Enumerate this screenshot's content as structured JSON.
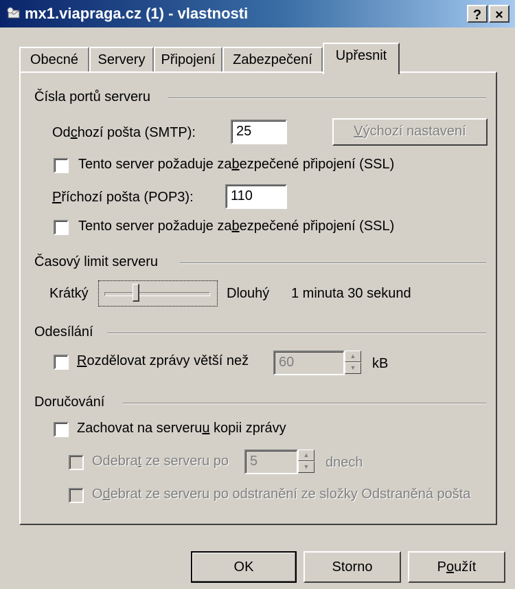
{
  "window": {
    "title": "mx1.viapraga.cz (1) - vlastnosti",
    "help_button": "?",
    "close_button": "×"
  },
  "tabs": [
    {
      "label": "Obecné",
      "active": false
    },
    {
      "label": "Servery",
      "active": false
    },
    {
      "label": "Připojení",
      "active": false
    },
    {
      "label": "Zabezpečení",
      "active": false
    },
    {
      "label": "Upřesnit",
      "active": true
    }
  ],
  "ports": {
    "group_label": "Čísla portů serveru",
    "smtp": {
      "label_pre": "Od",
      "label_ul": "c",
      "label_post": "hozí pošta (SMTP):",
      "value": "25"
    },
    "smtp_ssl": {
      "label_pre": "Tento server požaduje za",
      "label_ul": "b",
      "label_post": "ezpečené připojení (SSL)",
      "checked": false
    },
    "pop3": {
      "label_pre": "",
      "label_ul": "P",
      "label_post": "říchozí pošta (POP3):",
      "value": "110"
    },
    "pop3_ssl": {
      "label_pre": "Tento server požaduje za",
      "label_ul": "b",
      "label_post": "ezpečené připojení (SSL)",
      "checked": false
    },
    "default_button": {
      "label_pre": "",
      "label_ul": "V",
      "label_post": "ýchozí nastavení",
      "disabled": true
    }
  },
  "timeout": {
    "group_label": "Časový limit serveru",
    "short_label": "Krátký",
    "long_label": "Dlouhý",
    "value_text": "1 minuta 30 sekund",
    "level": 0.3
  },
  "sending": {
    "group_label": "Odesílání",
    "split": {
      "label_pre": "",
      "label_ul": "R",
      "label_post": "ozdělovat zprávy větší než",
      "checked": false
    },
    "split_value": "60",
    "unit": "kB"
  },
  "delivery": {
    "group_label": "Doručování",
    "keep_copy": {
      "label_pre": "Zachovat na serveru",
      "label_ul": "u",
      "label_post": " kopii zprávy",
      "checked": false
    },
    "remove_after": {
      "label_pre": "Odebra",
      "label_ul": "t",
      "label_post": " ze serveru po",
      "checked": false
    },
    "remove_after_value": "5",
    "days_unit": "dnech",
    "remove_deleted": {
      "label_pre": "O",
      "label_ul": "d",
      "label_post": "ebrat ze serveru po odstranění ze složky Odstraněná pošta",
      "checked": false
    }
  },
  "buttons": {
    "ok": "OK",
    "cancel": "Storno",
    "apply_pre": "P",
    "apply_ul": "o",
    "apply_post": "užít"
  }
}
